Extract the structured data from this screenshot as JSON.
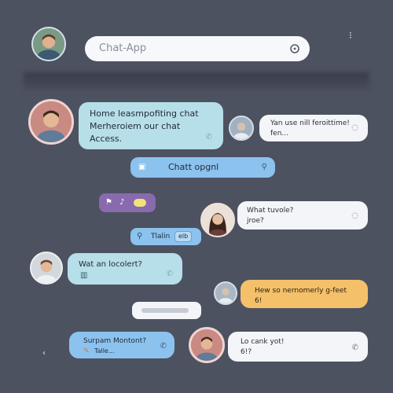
{
  "header": {
    "search_placeholder": "Chat-App",
    "menu_glyph": "⁝"
  },
  "messages": [
    {
      "line1": "Home leasmpofiting chat",
      "line2": "Merheroiem our chat",
      "line3": "Access."
    },
    {
      "line1": "Yan use nill feroittime!",
      "line2": "fen..."
    },
    {
      "text": "Chatt opgnl"
    },
    {
      "text": ""
    },
    {
      "line1": "What tuvole?",
      "line2": "jroe?"
    },
    {
      "text": "Tlalin",
      "badge": "elb"
    },
    {
      "text": "Wat an locolert?"
    },
    {
      "text": ""
    },
    {
      "text": "Hew so nernomerly g-feet",
      "line2": "6!"
    },
    {
      "line1": "Surpam Montont?",
      "line2": "Talle..."
    },
    {
      "line1": "Lo cank yot!",
      "line2": "6!?"
    }
  ],
  "colors": {
    "background": "#4d5261",
    "blue_light": "#b7dfe9",
    "blue_mid": "#8cc2ee",
    "purple": "#8a6aae",
    "white": "#f4f5f8",
    "orange": "#f5c06a"
  }
}
